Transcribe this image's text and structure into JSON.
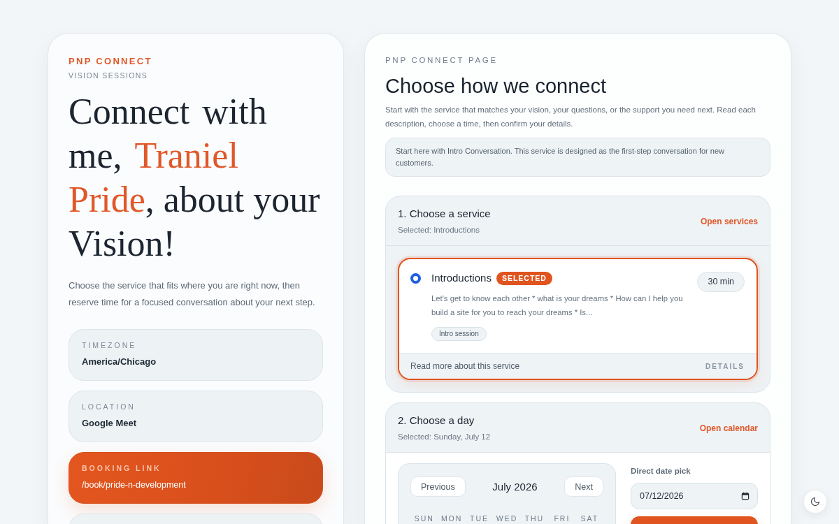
{
  "intro": {
    "brand": "PNP CONNECT",
    "tagline": "VISION SESSIONS",
    "headline": [
      {
        "text": "Connect with me, ",
        "accent": false
      },
      {
        "text": "Traniel Pride",
        "accent": true
      },
      {
        "text": ", about your Vision!",
        "accent": false
      }
    ],
    "description": "Choose the service that fits where you are right now, then reserve time for a focused conversation about your next step.",
    "details": [
      {
        "kind": "plain",
        "label": "TIMEZONE",
        "value": "America/Chicago"
      },
      {
        "kind": "plain",
        "label": "LOCATION",
        "value": "Google Meet"
      },
      {
        "kind": "accent",
        "label": "BOOKING LINK",
        "value": "/book/pride-n-development"
      },
      {
        "kind": "plain"
      }
    ]
  },
  "booking": {
    "eyebrow": "PNP CONNECT PAGE",
    "title": "Choose how we connect",
    "description": "Start with the service that matches your vision, your questions, or the support you need next. Read each description, choose a time, then confirm your details.",
    "notice": "Start here with Intro Conversation. This service is designed as the first-step conversation for new customers.",
    "steps": [
      {
        "kind": "services",
        "title": "1. Choose a service",
        "summary": "Selected: Introductions",
        "action": "Open services",
        "services": [
          {
            "name": "Introductions",
            "selected": true,
            "badge": "SELECTED",
            "duration": "30 min",
            "description": "Let's get to know each other * what is your dreams * How can I help you build a site for you to reach your dreams * Is...",
            "tags": [
              "Intro session"
            ],
            "link": "Read more about this service",
            "details": "DETAILS"
          }
        ]
      },
      {
        "kind": "calendar",
        "title": "2. Choose a day",
        "summary": "Selected: Sunday, July 12",
        "action": "Open calendar",
        "calendar": {
          "previous": "Previous",
          "month": "July 2026",
          "next": "Next",
          "weekdays": [
            "SUN",
            "MON",
            "TUE",
            "WED",
            "THU",
            "FRI",
            "SAT"
          ]
        },
        "date_pick": {
          "label": "Direct date pick",
          "value": "07/12/2026"
        },
        "buttons": [
          {
            "kind": "primary"
          }
        ]
      }
    ]
  }
}
